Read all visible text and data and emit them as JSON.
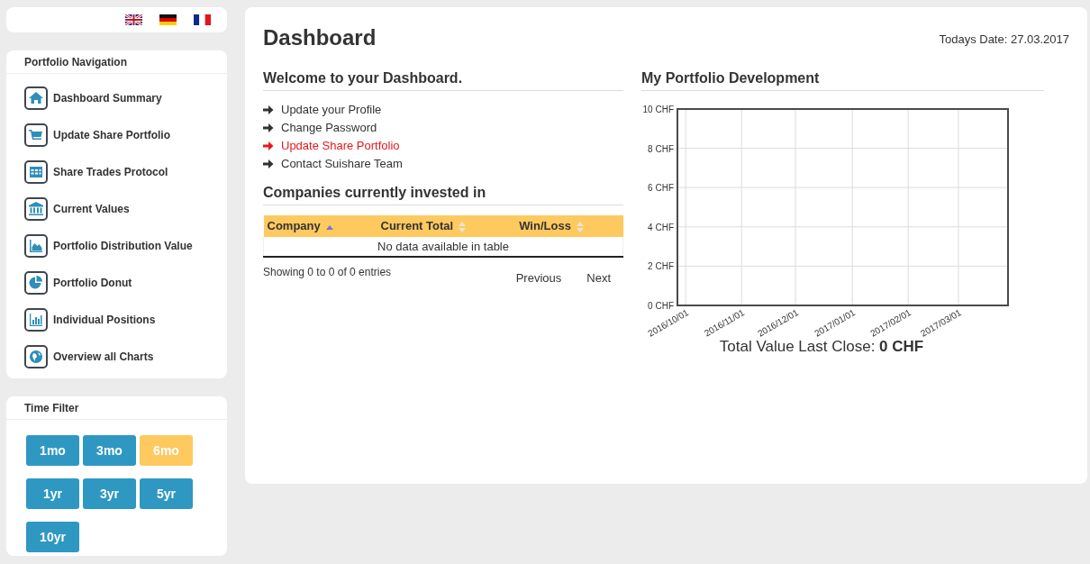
{
  "sidebar": {
    "navigation": {
      "title": "Portfolio Navigation",
      "items": [
        {
          "label": "Dashboard Summary"
        },
        {
          "label": "Update Share Portfolio"
        },
        {
          "label": "Share Trades Protocol"
        },
        {
          "label": "Current Values"
        },
        {
          "label": "Portfolio Distribution Value"
        },
        {
          "label": "Portfolio Donut"
        },
        {
          "label": "Individual Positions"
        },
        {
          "label": "Overview all Charts"
        }
      ]
    },
    "time_filter": {
      "title": "Time Filter",
      "buttons": [
        {
          "label": "1mo",
          "selected": false
        },
        {
          "label": "3mo",
          "selected": false
        },
        {
          "label": "6mo",
          "selected": true
        },
        {
          "label": "1yr",
          "selected": false
        },
        {
          "label": "3yr",
          "selected": false
        },
        {
          "label": "5yr",
          "selected": false
        },
        {
          "label": "10yr",
          "selected": false
        }
      ]
    }
  },
  "main": {
    "title": "Dashboard",
    "date": "Todays Date: 27.03.2017",
    "welcome": {
      "heading": "Welcome to your Dashboard.",
      "links": [
        {
          "label": "Update your Profile",
          "selected": false
        },
        {
          "label": "Change Password",
          "selected": false
        },
        {
          "label": "Update Share Portfolio",
          "selected": true
        },
        {
          "label": "Contact Suishare Team",
          "selected": false
        }
      ]
    },
    "companies": {
      "heading": "Companies currently invested in",
      "columns": [
        {
          "label": "Company",
          "sorted_ascending": true
        },
        {
          "label": "Current Total",
          "sorted_ascending": false
        },
        {
          "label": "Win/Loss",
          "sorted_ascending": false
        }
      ],
      "empty_message": "No data available in table",
      "info": "Showing 0 to 0 of 0 entries",
      "pagination": [
        "Previous",
        "Next"
      ]
    },
    "development": {
      "heading": "My Portfolio Development",
      "chart_data": {
        "type": "line",
        "grid": true,
        "ylim": [
          0,
          10
        ],
        "yticks": [
          {
            "value": 0,
            "label": "0 CHF"
          },
          {
            "value": 2,
            "label": "2 CHF"
          },
          {
            "value": 4,
            "label": "4 CHF"
          },
          {
            "value": 6,
            "label": "6 CHF"
          },
          {
            "value": 8,
            "label": "8 CHF"
          },
          {
            "value": 10,
            "label": "10 CHF"
          }
        ],
        "categories": [
          "2016/10/01",
          "2016/11/01",
          "2016/12/01",
          "2017/01/01",
          "2017/02/01",
          "2017/03/01"
        ]
      },
      "total": "Total Value Last Close: **0 CHF**"
    }
  }
}
